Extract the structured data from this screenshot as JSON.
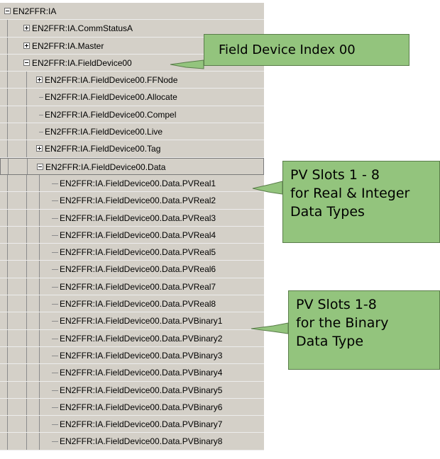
{
  "tree": {
    "rows": [
      {
        "label": "EN2FFR:IA",
        "level": 0,
        "expander": "minus"
      },
      {
        "label": "EN2FFR:IA.CommStatusA",
        "level": 1,
        "expander": "plus"
      },
      {
        "label": "EN2FFR:IA.Master",
        "level": 1,
        "expander": "plus"
      },
      {
        "label": "EN2FFR:IA.FieldDevice00",
        "level": 1,
        "expander": "minus"
      },
      {
        "label": "EN2FFR:IA.FieldDevice00.FFNode",
        "level": 2,
        "expander": "plus"
      },
      {
        "label": "EN2FFR:IA.FieldDevice00.Allocate",
        "level": 2,
        "expander": "none"
      },
      {
        "label": "EN2FFR:IA.FieldDevice00.Compel",
        "level": 2,
        "expander": "none"
      },
      {
        "label": "EN2FFR:IA.FieldDevice00.Live",
        "level": 2,
        "expander": "none"
      },
      {
        "label": "EN2FFR:IA.FieldDevice00.Tag",
        "level": 2,
        "expander": "plus"
      },
      {
        "label": "EN2FFR:IA.FieldDevice00.Data",
        "level": 2,
        "expander": "minus",
        "selected": true
      },
      {
        "label": "EN2FFR:IA.FieldDevice00.Data.PVReal1",
        "level": 3,
        "expander": "none"
      },
      {
        "label": "EN2FFR:IA.FieldDevice00.Data.PVReal2",
        "level": 3,
        "expander": "none"
      },
      {
        "label": "EN2FFR:IA.FieldDevice00.Data.PVReal3",
        "level": 3,
        "expander": "none"
      },
      {
        "label": "EN2FFR:IA.FieldDevice00.Data.PVReal4",
        "level": 3,
        "expander": "none"
      },
      {
        "label": "EN2FFR:IA.FieldDevice00.Data.PVReal5",
        "level": 3,
        "expander": "none"
      },
      {
        "label": "EN2FFR:IA.FieldDevice00.Data.PVReal6",
        "level": 3,
        "expander": "none"
      },
      {
        "label": "EN2FFR:IA.FieldDevice00.Data.PVReal7",
        "level": 3,
        "expander": "none"
      },
      {
        "label": "EN2FFR:IA.FieldDevice00.Data.PVReal8",
        "level": 3,
        "expander": "none"
      },
      {
        "label": "EN2FFR:IA.FieldDevice00.Data.PVBinary1",
        "level": 3,
        "expander": "none"
      },
      {
        "label": "EN2FFR:IA.FieldDevice00.Data.PVBinary2",
        "level": 3,
        "expander": "none"
      },
      {
        "label": "EN2FFR:IA.FieldDevice00.Data.PVBinary3",
        "level": 3,
        "expander": "none"
      },
      {
        "label": "EN2FFR:IA.FieldDevice00.Data.PVBinary4",
        "level": 3,
        "expander": "none"
      },
      {
        "label": "EN2FFR:IA.FieldDevice00.Data.PVBinary5",
        "level": 3,
        "expander": "none"
      },
      {
        "label": "EN2FFR:IA.FieldDevice00.Data.PVBinary6",
        "level": 3,
        "expander": "none"
      },
      {
        "label": "EN2FFR:IA.FieldDevice00.Data.PVBinary7",
        "level": 3,
        "expander": "none"
      },
      {
        "label": "EN2FFR:IA.FieldDevice00.Data.PVBinary8",
        "level": 3,
        "expander": "none"
      }
    ]
  },
  "callouts": {
    "field_device": {
      "lines": [
        "Field Device Index 00"
      ]
    },
    "pv_real": {
      "lines": [
        "PV Slots 1 - 8",
        "for Real & Integer",
        "Data Types"
      ]
    },
    "pv_binary": {
      "lines": [
        "PV Slots 1-8",
        "for the Binary",
        "Data Type"
      ]
    }
  },
  "colors": {
    "tree_background": "#d4d0c8",
    "callout_fill": "#93c47d",
    "callout_border": "#5a7d4a"
  }
}
